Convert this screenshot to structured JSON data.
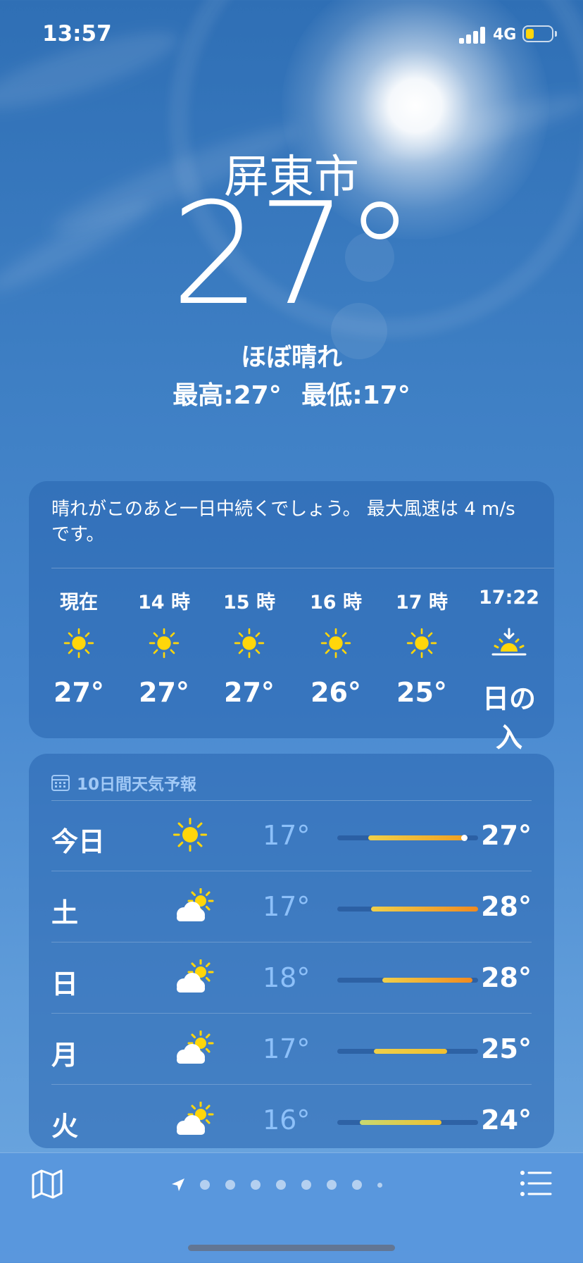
{
  "status_bar": {
    "time": "13:57",
    "network": "4G",
    "battery_color": "#ffd60a"
  },
  "current": {
    "city": "屏東市",
    "temperature": "27°",
    "condition": "ほぼ晴れ",
    "high": "最高:27°",
    "low": "最低:17°"
  },
  "hourly": {
    "summary": "晴れがこのあと一日中続くでしょう。 最大風速は 4 m/s です。",
    "items": [
      {
        "label": "現在",
        "icon": "sun-icon",
        "temp": "27°"
      },
      {
        "label": "14 時",
        "icon": "sun-icon",
        "temp": "27°"
      },
      {
        "label": "15 時",
        "icon": "sun-icon",
        "temp": "27°"
      },
      {
        "label": "16 時",
        "icon": "sun-icon",
        "temp": "26°"
      },
      {
        "label": "17 時",
        "icon": "sun-icon",
        "temp": "25°"
      },
      {
        "label": "17:22",
        "icon": "sunset-icon",
        "temp": "日の入"
      }
    ]
  },
  "forecast": {
    "title": "10日間天気予報",
    "days": [
      {
        "day": "今日",
        "icon": "sun-icon",
        "low": "17°",
        "high": "27°",
        "range_start": 0.22,
        "range_end": 0.9,
        "current_marker": 0.9,
        "gradient": [
          "#f0d04a",
          "#f0a020"
        ]
      },
      {
        "day": "土",
        "icon": "partly-cloudy-icon",
        "low": "17°",
        "high": "28°",
        "range_start": 0.24,
        "range_end": 1.0,
        "gradient": [
          "#f0d04a",
          "#f08a20"
        ]
      },
      {
        "day": "日",
        "icon": "partly-cloudy-icon",
        "low": "18°",
        "high": "28°",
        "range_start": 0.32,
        "range_end": 0.96,
        "gradient": [
          "#f0d04a",
          "#f08a20"
        ]
      },
      {
        "day": "月",
        "icon": "partly-cloudy-icon",
        "low": "17°",
        "high": "25°",
        "range_start": 0.26,
        "range_end": 0.78,
        "gradient": [
          "#f0d04a",
          "#f0c030"
        ]
      },
      {
        "day": "火",
        "icon": "partly-cloudy-icon",
        "low": "16°",
        "high": "24°",
        "range_start": 0.16,
        "range_end": 0.74,
        "gradient": [
          "#c8d870",
          "#f0c030"
        ]
      }
    ]
  },
  "pager": {
    "page_dots": 8
  }
}
